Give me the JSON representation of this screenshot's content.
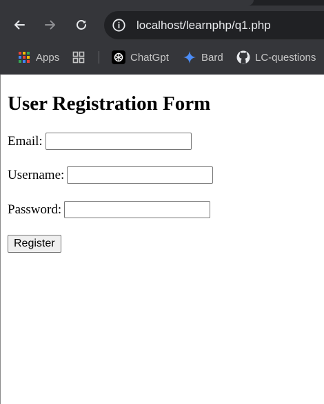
{
  "browser": {
    "url": "localhost/learnphp/q1.php",
    "bookmarks": [
      {
        "label": "Apps",
        "icon": "apps-grid-icon"
      },
      {
        "label": "",
        "icon": "tab-groups-icon"
      },
      {
        "label": "ChatGpt",
        "icon": "chatgpt-icon"
      },
      {
        "label": "Bard",
        "icon": "bard-sparkle-icon"
      },
      {
        "label": "LC-questions",
        "icon": "github-icon"
      }
    ],
    "colors": {
      "toolbar": "#35363a",
      "omnibox": "#202124",
      "text": "#e8eaed",
      "bard_blue": "#4c8df6"
    }
  },
  "form": {
    "title": "User Registration Form",
    "fields": [
      {
        "label": "Email:",
        "value": "",
        "type": "email"
      },
      {
        "label": "Username:",
        "value": "",
        "type": "text"
      },
      {
        "label": "Password:",
        "value": "",
        "type": "password"
      }
    ],
    "submit_label": "Register"
  }
}
